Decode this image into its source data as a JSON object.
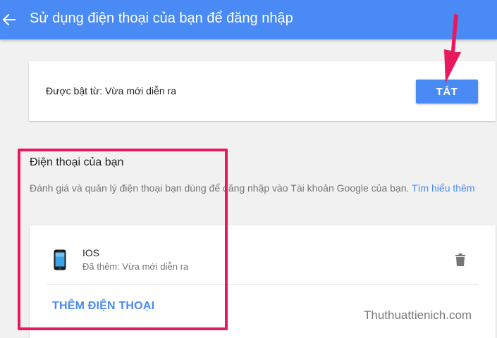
{
  "header": {
    "title": "Sử dụng điện thoại của bạn để đăng nhập",
    "back_icon": "arrow-left-icon"
  },
  "status_card": {
    "status_text": "Được bật từ: Vừa mới diễn ra",
    "off_button_label": "TẮT"
  },
  "phones_section": {
    "title": "Điện thoại của bạn",
    "description": "Đánh giá và quản lý điện thoại bạn dùng để đăng nhập vào Tài khoản Google của bạn.",
    "learn_more_label": "Tìm hiểu thêm",
    "phones": [
      {
        "name": "IOS",
        "added": "Đã thêm: Vừa mới diễn ra",
        "icon": "smartphone-icon",
        "delete_icon": "trash-icon"
      }
    ],
    "add_phone_label": "THÊM ĐIỆN THOẠI"
  },
  "watermark": "Thuthuattienich.com",
  "colors": {
    "primary": "#4a8af4",
    "annotation": "#e8195d",
    "background": "#f1f1f1"
  }
}
